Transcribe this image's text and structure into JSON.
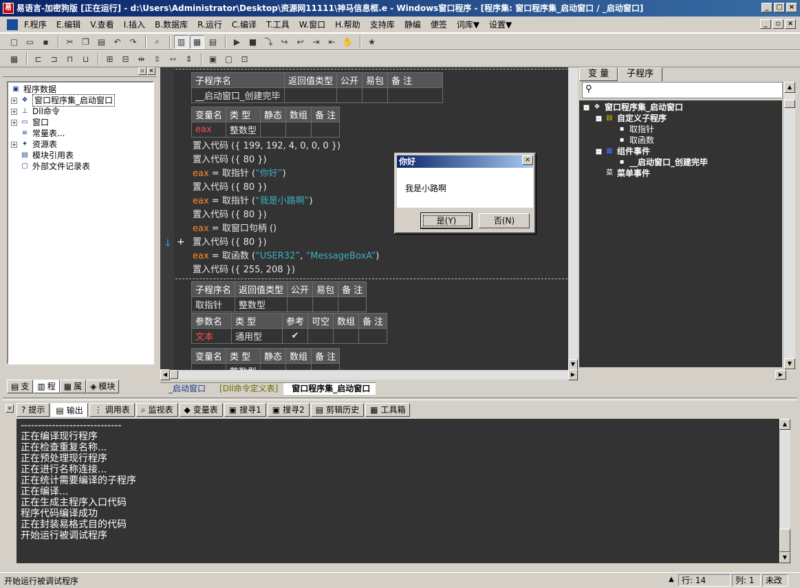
{
  "window": {
    "title": "易语言-加密狗版 [正在运行] - d:\\Users\\Administrator\\Desktop\\资源网11111\\神马信息框.e - Windows窗口程序 - [程序集: 窗口程序集_启动窗口 / _启动窗口]"
  },
  "menu": [
    "F.程序",
    "E.编辑",
    "V.查看",
    "I.插入",
    "B.数据库",
    "R.运行",
    "C.编译",
    "T.工具",
    "W.窗口",
    "H.帮助",
    "支持库",
    "静编",
    "便签",
    "词库▼",
    "设置▼"
  ],
  "left_panel": {
    "tree": [
      {
        "label": "程序数据",
        "level": 0,
        "icon": "program-data-icon",
        "expand": ""
      },
      {
        "label": "窗口程序集_启动窗口",
        "level": 1,
        "icon": "assembly-icon",
        "expand": "+",
        "selected": true
      },
      {
        "label": "Dll命令",
        "level": 1,
        "icon": "dll-icon",
        "expand": "+"
      },
      {
        "label": "窗口",
        "level": 1,
        "icon": "window-icon",
        "expand": "+"
      },
      {
        "label": "常量表...",
        "level": 1,
        "icon": "constant-icon",
        "expand": ""
      },
      {
        "label": "资源表",
        "level": 1,
        "icon": "resource-icon",
        "expand": "+"
      },
      {
        "label": "模块引用表",
        "level": 1,
        "icon": "module-icon",
        "expand": ""
      },
      {
        "label": "外部文件记录表",
        "level": 1,
        "icon": "file-icon",
        "expand": ""
      }
    ],
    "tabs": [
      "支",
      "程",
      "属",
      "模块"
    ]
  },
  "editor": {
    "table1_header": [
      "子程序名",
      "返回值类型",
      "公开",
      "易包",
      "备 注"
    ],
    "table1_row": [
      "__启动窗口_创建完毕",
      "",
      "",
      "",
      ""
    ],
    "table2_header": [
      "变量名",
      "类 型",
      "静态",
      "数组",
      "备 注"
    ],
    "table2_row": [
      "eax",
      "整数型",
      "",
      "",
      ""
    ],
    "code_lines": [
      {
        "parts": [
          [
            "置入代码 ({ 199, 192, 4, 0, 0, 0 })",
            ""
          ]
        ]
      },
      {
        "parts": [
          [
            "置入代码 ({ 80 })",
            ""
          ]
        ]
      },
      {
        "parts": [
          [
            "eax",
            "kw"
          ],
          [
            " = 取指针 (",
            ""
          ],
          [
            "“你好”",
            "str"
          ],
          [
            ")",
            ""
          ]
        ]
      },
      {
        "parts": [
          [
            "置入代码 ({ 80 })",
            ""
          ]
        ]
      },
      {
        "parts": [
          [
            "eax",
            "kw"
          ],
          [
            " = 取指针 (",
            ""
          ],
          [
            "“我是小路啊”",
            "str"
          ],
          [
            ")",
            ""
          ]
        ]
      },
      {
        "parts": [
          [
            "置入代码 ({ 80 })",
            ""
          ]
        ]
      },
      {
        "parts": [
          [
            "eax",
            "kw"
          ],
          [
            " = 取窗口句柄 ()",
            ""
          ]
        ]
      },
      {
        "parts": [
          [
            "置入代码 ({ 80 })",
            ""
          ]
        ]
      },
      {
        "parts": [
          [
            "eax",
            "kw"
          ],
          [
            " = 取函数 (",
            ""
          ],
          [
            "“USER32”",
            "str"
          ],
          [
            ", ",
            ""
          ],
          [
            "“MessageBoxA”",
            "str"
          ],
          [
            ")",
            ""
          ]
        ]
      },
      {
        "parts": [
          [
            "置入代码 ({ 255, 208 })",
            ""
          ]
        ]
      }
    ],
    "table3_header": [
      "子程序名",
      "返回值类型",
      "公开",
      "易包",
      "备 注"
    ],
    "table3_row": [
      "取指针",
      "整数型",
      "",
      "",
      ""
    ],
    "table4_header": [
      "参数名",
      "类 型",
      "参考",
      "可空",
      "数组",
      "备 注"
    ],
    "table4_row": [
      "文本",
      "通用型",
      "✔",
      "",
      "",
      ""
    ],
    "table5_header": [
      "变量名",
      "类 型",
      "静态",
      "数组",
      "备 注"
    ],
    "table5_row_partial": "整数型",
    "tabs": [
      "_启动窗口",
      "[Dll命令定义表]",
      "窗口程序集_启动窗口"
    ]
  },
  "right_panel": {
    "tabs": [
      "变 量",
      "子程序"
    ],
    "tree": [
      {
        "label": "窗口程序集_启动窗口",
        "level": 0,
        "expand": "-"
      },
      {
        "label": "自定义子程序",
        "level": 1,
        "expand": "-"
      },
      {
        "label": "取指针",
        "level": 2,
        "expand": ""
      },
      {
        "label": "取函数",
        "level": 2,
        "expand": ""
      },
      {
        "label": "组件事件",
        "level": 1,
        "expand": "-"
      },
      {
        "label": "__启动窗口_创建完毕",
        "level": 2,
        "expand": ""
      },
      {
        "label": "菜单事件",
        "level": 1,
        "expand": ""
      }
    ]
  },
  "dialog": {
    "title": "你好",
    "message": "我是小路啊",
    "yes_label": "是(Y)",
    "no_label": "否(N)"
  },
  "output_tabs": [
    "提示",
    "输出",
    "调用表",
    "监视表",
    "变量表",
    "搜寻1",
    "搜寻2",
    "剪辑历史",
    "工具箱"
  ],
  "output_lines": [
    "-----------------------------",
    "正在编译现行程序",
    "正在检查重复名称...",
    "正在预处理现行程序",
    "正在进行名称连接...",
    "正在统计需要编译的子程序",
    "正在编译...",
    "正在生成主程序入口代码",
    "程序代码编译成功",
    "正在封装易格式目的代码",
    "开始运行被调试程序"
  ],
  "status": {
    "message": "开始运行被调试程序",
    "line": "行: 14",
    "col": "列: 1",
    "mode": "未改"
  }
}
